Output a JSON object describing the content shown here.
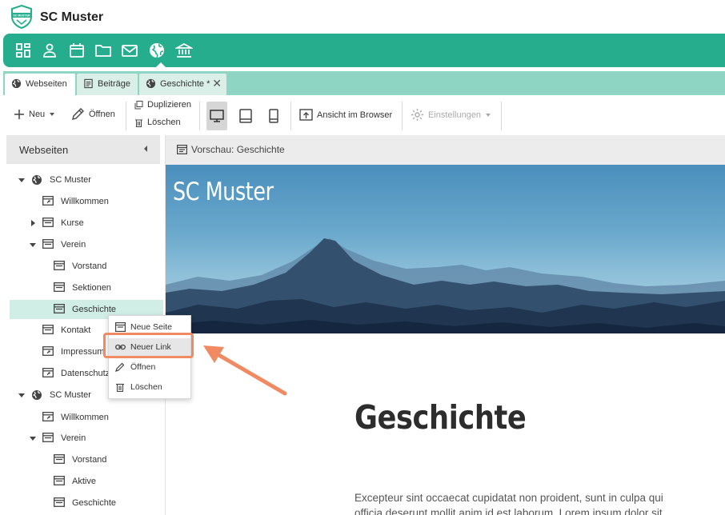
{
  "app": {
    "title": "SC Muster",
    "logo_text": "SC MUSTER"
  },
  "modules": [
    {
      "name": "dashboard-icon"
    },
    {
      "name": "user-icon"
    },
    {
      "name": "calendar-icon"
    },
    {
      "name": "folder-icon"
    },
    {
      "name": "mail-icon"
    },
    {
      "name": "globe-icon",
      "active": true
    },
    {
      "name": "bank-icon"
    }
  ],
  "tabs": [
    {
      "label": "Webseiten",
      "active": true
    },
    {
      "label": "Beiträge",
      "active": false
    },
    {
      "label": "Geschichte *",
      "active": false,
      "closable": true
    }
  ],
  "toolbar": {
    "new_label": "Neu",
    "open_label": "Öffnen",
    "duplicate_label": "Duplizieren",
    "delete_label": "Löschen",
    "browser_label": "Ansicht im Browser",
    "settings_label": "Einstellungen"
  },
  "sidebar": {
    "title": "Webseiten",
    "items": [
      {
        "label": "SC Muster"
      },
      {
        "label": "Willkommen"
      },
      {
        "label": "Kurse"
      },
      {
        "label": "Verein"
      },
      {
        "label": "Vorstand"
      },
      {
        "label": "Sektionen"
      },
      {
        "label": "Geschichte",
        "selected": true
      },
      {
        "label": "Kontakt"
      },
      {
        "label": "Impressum"
      },
      {
        "label": "Datenschutz"
      },
      {
        "label": "SC Muster"
      },
      {
        "label": "Willkommen"
      },
      {
        "label": "Verein"
      },
      {
        "label": "Vorstand"
      },
      {
        "label": "Aktive"
      },
      {
        "label": "Geschichte"
      }
    ]
  },
  "context_menu": {
    "items": [
      {
        "label": "Neue Seite"
      },
      {
        "label": "Neuer Link",
        "highlighted": true
      },
      {
        "label": "Öffnen"
      },
      {
        "label": "Löschen"
      }
    ]
  },
  "preview": {
    "header": "Vorschau: Geschichte",
    "hero_title": "SC Muster",
    "page_heading": "Geschichte",
    "body_line1": "Excepteur sint occaecat cupidatat non proident, sunt in culpa qui",
    "body_line2": "officia deserunt mollit anim id est laborum. Lorem ipsum dolor sit"
  },
  "colors": {
    "accent": "#26ad8d",
    "tab_strip": "#8fd5c4",
    "selected_row": "#d0ede6",
    "highlight_callout": "#f08a62"
  }
}
